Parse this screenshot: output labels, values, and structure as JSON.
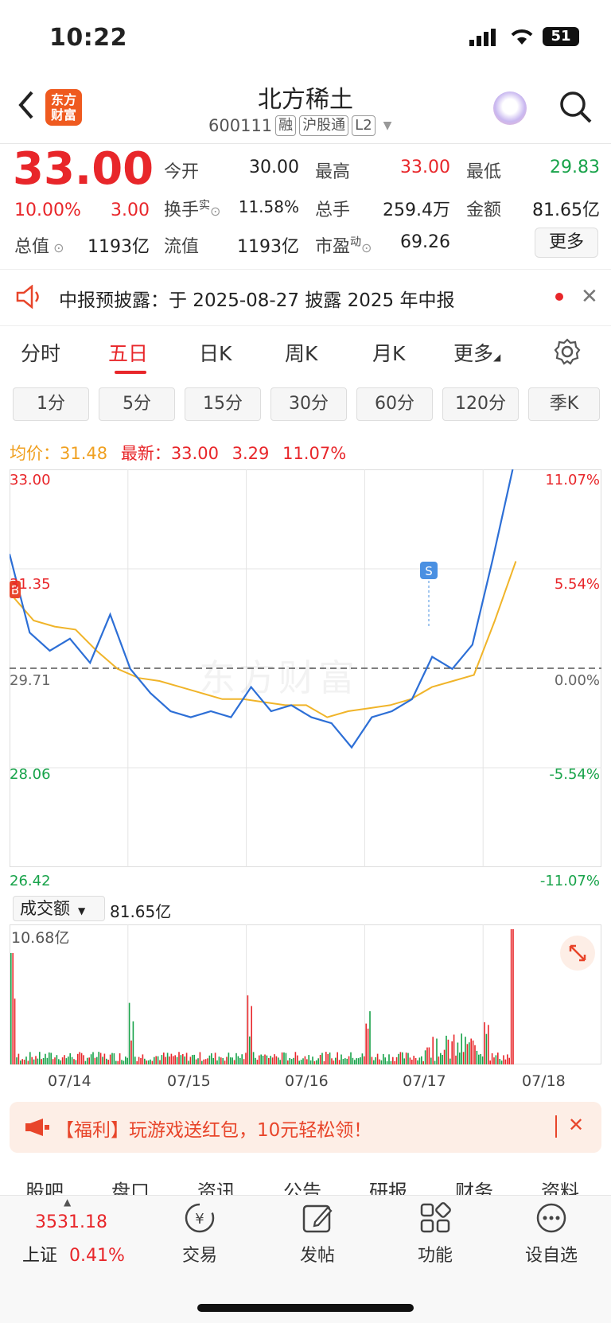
{
  "status": {
    "time": "10:22",
    "battery": "51"
  },
  "header": {
    "title": "北方稀土",
    "code": "600111",
    "tags": [
      "融",
      "沪股通",
      "L2"
    ],
    "logo_text": "东方\n财富"
  },
  "quote": {
    "price": "33.00",
    "change_pct": "10.00%",
    "change": "3.00",
    "fields": {
      "open_label": "今开",
      "open": "30.00",
      "high_label": "最高",
      "high": "33.00",
      "low_label": "最低",
      "low": "29.83",
      "turnover_label": "换手",
      "turnover_sup": "实",
      "turnover": "11.58%",
      "volume_label": "总手",
      "volume": "259.4万",
      "amount_label": "金额",
      "amount": "81.65亿",
      "mktcap_label": "总值",
      "mktcap": "1193亿",
      "float_label": "流值",
      "float": "1193亿",
      "pe_label": "市盈",
      "pe_sup": "动",
      "pe": "69.26"
    },
    "more": "更多"
  },
  "notice": {
    "text": "中报预披露：于 2025-08-27 披露 2025 年中报"
  },
  "period_tabs": [
    "分时",
    "五日",
    "日K",
    "周K",
    "月K",
    "更多"
  ],
  "active_period": "五日",
  "interval_tabs": [
    "1分",
    "5分",
    "15分",
    "30分",
    "60分",
    "120分",
    "季K"
  ],
  "legend": {
    "avg_label": "均价：",
    "avg": "31.48",
    "latest_label": "最新：",
    "latest": "33.00",
    "latest_change": "3.29",
    "latest_pct": "11.07%"
  },
  "watermark": "东方财富",
  "chart_data": {
    "type": "line",
    "x": [
      "07/14",
      "07/15",
      "07/16",
      "07/17",
      "07/18"
    ],
    "price_axis": [
      "33.00",
      "31.35",
      "29.71",
      "28.06",
      "26.42"
    ],
    "pct_axis": [
      "11.07%",
      "5.54%",
      "0.00%",
      "-5.54%",
      "-11.07%"
    ],
    "ylim": [
      26.42,
      33.0
    ],
    "base": 29.71,
    "series": [
      {
        "name": "均价",
        "color": "#f0b429",
        "values": [
          30.9,
          30.5,
          30.4,
          30.35,
          30.0,
          29.7,
          29.55,
          29.5,
          29.4,
          29.3,
          29.2,
          29.2,
          29.15,
          29.1,
          29.1,
          28.9,
          29.0,
          29.05,
          29.1,
          29.2,
          29.4,
          29.5,
          29.6,
          30.5,
          31.48
        ]
      },
      {
        "name": "最新",
        "color": "#2d6fd6",
        "values": [
          31.6,
          30.3,
          30.0,
          30.2,
          29.8,
          30.6,
          29.7,
          29.3,
          29.0,
          28.9,
          29.0,
          28.9,
          29.4,
          29.0,
          29.1,
          28.9,
          28.8,
          28.4,
          28.9,
          29.0,
          29.2,
          29.9,
          29.7,
          30.1,
          31.5,
          33.0
        ]
      }
    ],
    "markers": [
      "B",
      "S"
    ],
    "volume": {
      "label": "成交额",
      "total": "81.65亿",
      "max": "10.68亿"
    }
  },
  "banner": {
    "text": "【福利】玩游戏送红包，10元轻松领！"
  },
  "bottom_tabs": [
    "股吧",
    "盘口",
    "资讯",
    "公告",
    "研报",
    "财务",
    "资料"
  ],
  "bottom_nav": {
    "index_value": "3531.18",
    "index_name": "上证",
    "index_pct": "0.41%",
    "items": [
      "交易",
      "发帖",
      "功能",
      "设自选"
    ]
  }
}
